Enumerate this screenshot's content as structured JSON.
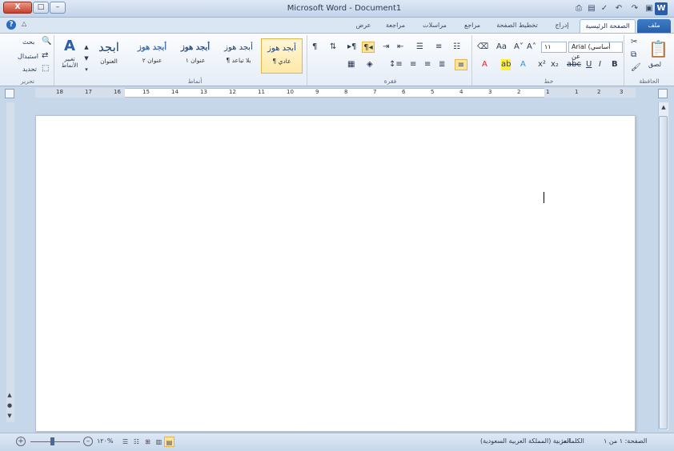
{
  "window": {
    "title": "Microsoft Word - Document1",
    "close_label": "X",
    "max_label": "□",
    "min_label": "–",
    "app_icon": "W"
  },
  "tabs": [
    {
      "label": "ملف"
    },
    {
      "label": "الصفحة الرئيسية"
    },
    {
      "label": "إدراج"
    },
    {
      "label": "تخطيط الصفحة"
    },
    {
      "label": "مراجع"
    },
    {
      "label": "مراسلات"
    },
    {
      "label": "مراجعة"
    },
    {
      "label": "عرض"
    }
  ],
  "ribbon": {
    "clipboard": {
      "label": "الحافظة",
      "paste": "لصق"
    },
    "font": {
      "label": "خط",
      "font_name": "Arial (أساسي عن",
      "font_size": "١١"
    },
    "paragraph": {
      "label": "فقرة"
    },
    "styles": {
      "label": "أنماط",
      "items": [
        {
          "sample": "أبجد هوز",
          "name": "¶ عادي"
        },
        {
          "sample": "أبجد هوز",
          "name": "¶ بلا تباعد"
        },
        {
          "sample": "أبجد هوز",
          "name": "عنوان ١"
        },
        {
          "sample": "أبجد هوز",
          "name": "عنوان ٢"
        },
        {
          "sample": "ابجد",
          "name": "العنوان"
        }
      ],
      "change_styles": "تغيير الأنماط"
    },
    "editing": {
      "label": "تحرير",
      "find": "بحث",
      "replace": "استبدال",
      "select": "تحديد"
    }
  },
  "ruler": {
    "numbers": [
      "18",
      "17",
      "16",
      "15",
      "14",
      "13",
      "12",
      "11",
      "10",
      "9",
      "8",
      "7",
      "6",
      "5",
      "4",
      "3",
      "2",
      "1",
      "1",
      "2",
      "3"
    ]
  },
  "status": {
    "page": "الصفحة: ١ من ١",
    "words": "الكلمات: ٠",
    "language": "العربية (المملكة العربية السعودية)",
    "zoom": "١٢٠%"
  },
  "colors": {
    "accent": "#2a5ea8",
    "ribbon_bg": "#e5edf7",
    "workspace": "#c7d7ea"
  }
}
